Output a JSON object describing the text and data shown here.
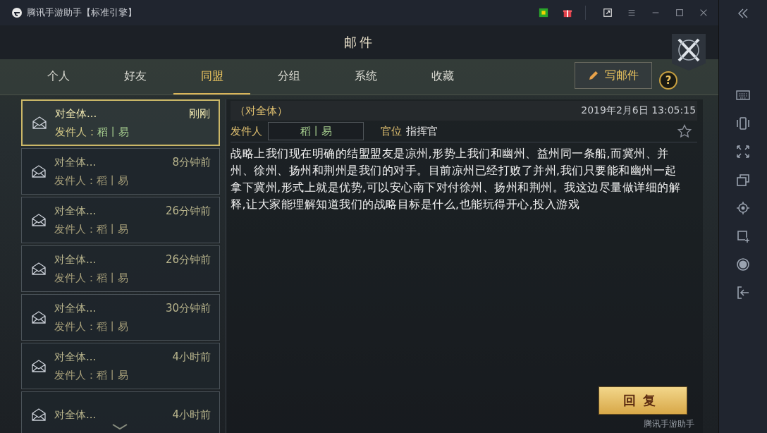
{
  "window": {
    "title": "腾讯手游助手【标准引擎】"
  },
  "header": {
    "title": "邮件"
  },
  "tabs": [
    {
      "label": "个人",
      "selected": false
    },
    {
      "label": "好友",
      "selected": false
    },
    {
      "label": "同盟",
      "selected": true
    },
    {
      "label": "分组",
      "selected": false
    },
    {
      "label": "系统",
      "selected": false
    },
    {
      "label": "收藏",
      "selected": false
    }
  ],
  "compose_button": {
    "label": "写邮件"
  },
  "help_button": {
    "label": "?"
  },
  "mails": [
    {
      "subject": "对全体...",
      "sender_label": "发件人：",
      "sender": "稻丨易",
      "time": "刚刚",
      "selected": true
    },
    {
      "subject": "对全体...",
      "sender_label": "发件人：",
      "sender": "稻丨易",
      "time": "8分钟前",
      "selected": false
    },
    {
      "subject": "对全体...",
      "sender_label": "发件人：",
      "sender": "稻丨易",
      "time": "26分钟前",
      "selected": false
    },
    {
      "subject": "对全体...",
      "sender_label": "发件人：",
      "sender": "稻丨易",
      "time": "26分钟前",
      "selected": false
    },
    {
      "subject": "对全体...",
      "sender_label": "发件人：",
      "sender": "稻丨易",
      "time": "30分钟前",
      "selected": false
    },
    {
      "subject": "对全体...",
      "sender_label": "发件人：",
      "sender": "稻丨易",
      "time": "4小时前",
      "selected": false
    },
    {
      "subject": "对全体...",
      "time": "4小时前",
      "selected": false
    }
  ],
  "message": {
    "recipient": "（对全体）",
    "date": "2019年2月6日 13:05:15",
    "sender_label": "发件人",
    "sender": "稻丨易",
    "rank_label": "官位",
    "rank": "指挥官",
    "starred": false,
    "body": "战略上我们现在明确的结盟盟友是凉州,形势上我们和幽州、益州同一条船,而冀州、并州、徐州、扬州和荆州是我们的对手。目前凉州已经打败了并州,我们只要能和幽州一起拿下冀州,形式上就是优势,可以安心南下对付徐州、扬州和荆州。我这边尽量做详细的解释,让大家能理解知道我们的战略目标是什么,也能玩得开心,投入游戏"
  },
  "reply_button": {
    "label": "回复"
  },
  "overlay_logo": {
    "text": "腾讯手游助手"
  }
}
